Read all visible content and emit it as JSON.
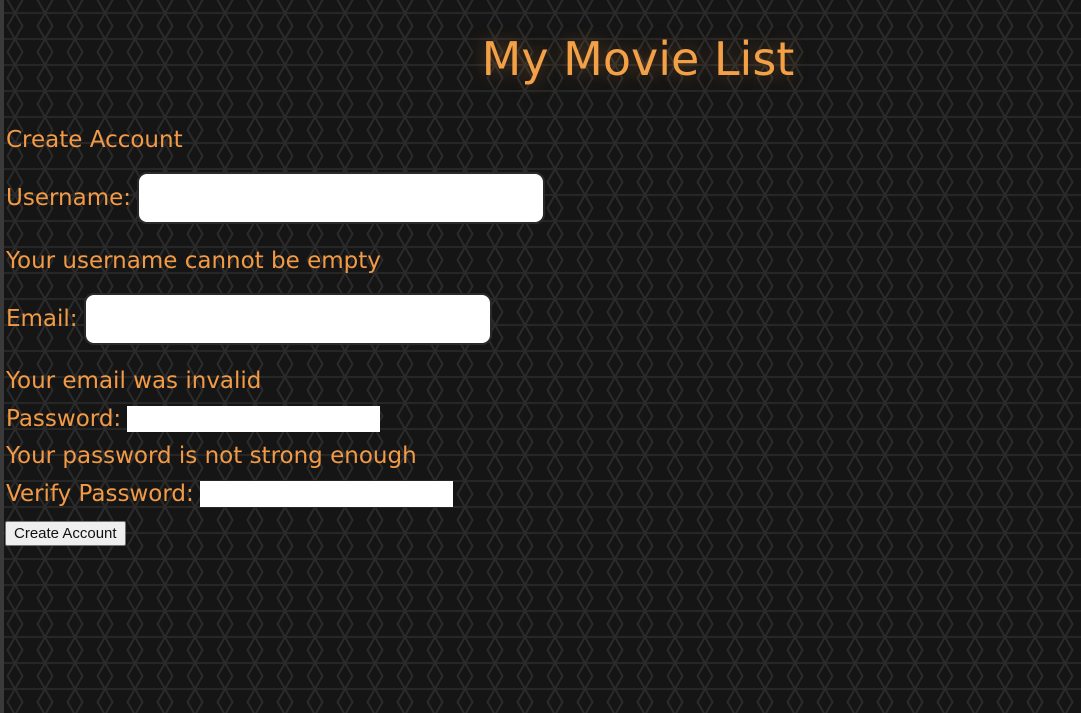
{
  "header": {
    "title": "My Movie List"
  },
  "form": {
    "heading": "Create Account",
    "username": {
      "label": "Username:",
      "value": "",
      "error": "Your username cannot be empty"
    },
    "email": {
      "label": "Email:",
      "value": "",
      "error": "Your email was invalid"
    },
    "password": {
      "label": "Password:",
      "value": "",
      "error": "Your password is not strong enough"
    },
    "verify_password": {
      "label": "Verify Password:",
      "value": ""
    },
    "submit_label": "Create Account"
  },
  "colors": {
    "accent": "#f29a45",
    "background": "#151515"
  }
}
